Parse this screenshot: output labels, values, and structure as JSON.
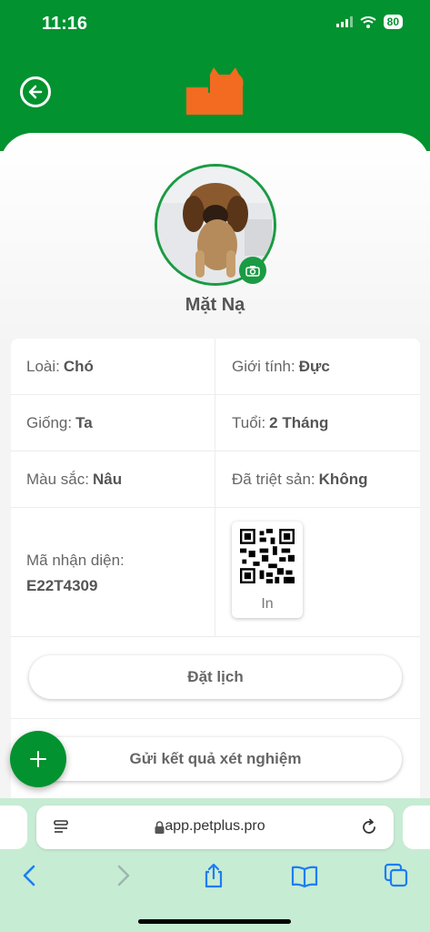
{
  "status_bar": {
    "time": "11:16",
    "battery": "80"
  },
  "pet": {
    "name": "Mặt Nạ"
  },
  "info": {
    "species_label": "Loài:",
    "species_value": "Chó",
    "gender_label": "Giới tính:",
    "gender_value": "Đực",
    "breed_label": "Giống:",
    "breed_value": "Ta",
    "age_label": "Tuổi:",
    "age_value": "2 Tháng",
    "color_label": "Màu sắc:",
    "color_value": "Nâu",
    "neutered_label": "Đã triệt sản:",
    "neutered_value": "Không",
    "id_label": "Mã nhận diện:",
    "id_value": "E22T4309",
    "qr_print_label": "In"
  },
  "actions": {
    "booking": "Đặt lịch",
    "send_results": "Gửi kết quả xét nghiệm"
  },
  "browser": {
    "url": "app.petplus.pro"
  },
  "colors": {
    "brand_green": "#02922f",
    "logo_orange": "#f26b21",
    "browser_bg": "#c7ecd4"
  },
  "icons": [
    "back-arrow-icon",
    "camera-icon",
    "qr-code-icon",
    "plus-icon",
    "lock-icon",
    "reload-icon",
    "share-icon",
    "bookmarks-icon",
    "tabs-icon"
  ]
}
